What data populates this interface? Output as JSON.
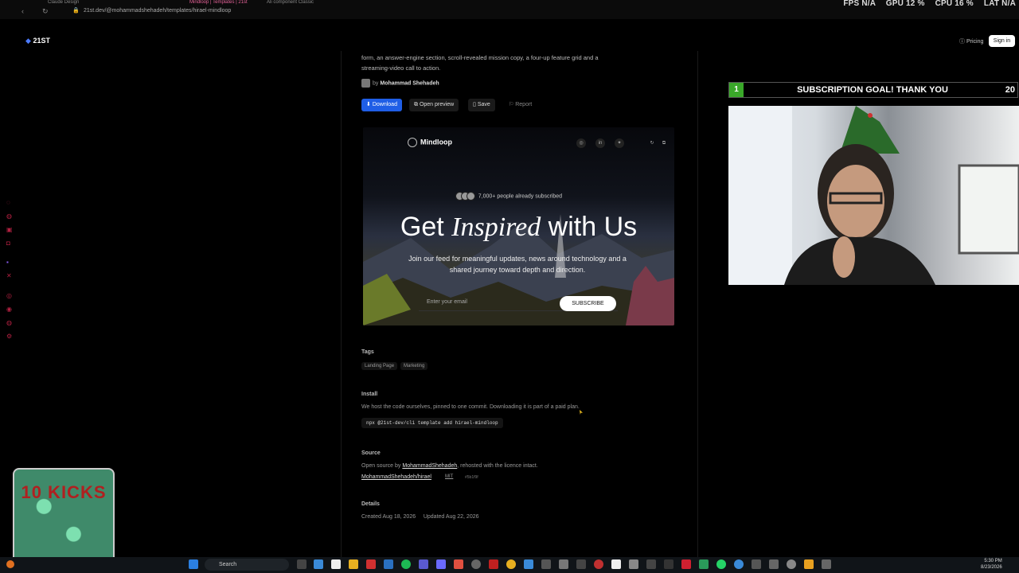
{
  "browser": {
    "tabs": [
      "Claude Design",
      "Mindloop | Templates | 21st",
      "Ali component Classic"
    ],
    "url": "21st.dev/@mohammadshehadeh/templates/hirael-mindloop"
  },
  "stats": {
    "fps": "FPS N/A",
    "gpu": "GPU 12 %",
    "cpu": "CPU 16 %",
    "lat": "LAT N/A"
  },
  "site": {
    "logo": "21ST",
    "pricing": "Pricing",
    "signin": "Sign in"
  },
  "template": {
    "description": "form, an answer-engine section, scroll-revealed mission copy, a four-up feature grid and a streaming-video call to action.",
    "author_prefix": "by",
    "author": "Mohammad Shehadeh",
    "actions": {
      "download": "Download",
      "preview": "Open preview",
      "save": "Save",
      "report": "Report"
    }
  },
  "preview": {
    "brand": "Mindloop",
    "subscribers": "7,000+ people already subscribed",
    "headline_1": "Get",
    "headline_2": "Inspired",
    "headline_3": "with Us",
    "body": "Join our feed for meaningful updates, news around technology and a shared journey toward depth and direction.",
    "email_placeholder": "Enter your email",
    "subscribe": "SUBSCRIBE"
  },
  "tags": {
    "title": "Tags",
    "items": [
      "Landing Page",
      "Marketing"
    ]
  },
  "install": {
    "title": "Install",
    "text": "We host the code ourselves, pinned to one commit. Downloading it is part of a paid plan.",
    "command": "npx @21st-dev/cli template add hirael-mindloop"
  },
  "source": {
    "title": "Source",
    "text_prefix": "Open source by",
    "text_author": "MohammadShehadeh",
    "text_suffix": ", rehosted with the licence intact.",
    "repo": "MohammadShehadeh/hirael",
    "license": "MIT",
    "sha": "#5b1f9f"
  },
  "details": {
    "title": "Details",
    "dates": "Created Aug 18, 2026     Updated Aug 22, 2026"
  },
  "overlay": {
    "goal_num": "1",
    "goal_text": "SUBSCRIPTION GOAL! THANK YOU",
    "goal_count": "20",
    "jar_label": "10 KICKS"
  },
  "taskbar": {
    "search": "Search",
    "time": "5:30 PM",
    "date": "8/23/2026"
  },
  "colors": {
    "accent": "#1f5ee6",
    "goal_green": "#3aa82a"
  }
}
